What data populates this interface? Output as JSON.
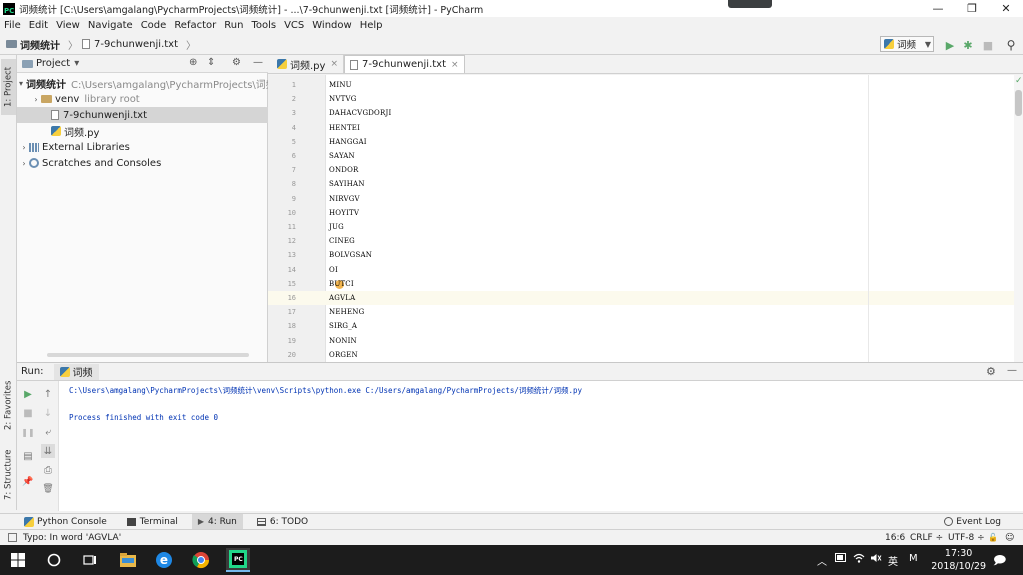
{
  "window": {
    "title": "词频统计 [C:\\Users\\amgalang\\PycharmProjects\\词频统计] - ...\\7-9chunwenji.txt [词频统计] - PyCharm",
    "app_icon_text": "PC",
    "minimize": "—",
    "maximize": "❐",
    "close": "✕"
  },
  "menu": [
    "File",
    "Edit",
    "View",
    "Navigate",
    "Code",
    "Refactor",
    "Run",
    "Tools",
    "VCS",
    "Window",
    "Help"
  ],
  "breadcrumb": {
    "project": "词频统计",
    "file": "7-9chunwenji.txt"
  },
  "run_config": {
    "label": "词频",
    "dropdown": "▼"
  },
  "toolbar_icons": {
    "run": "▶",
    "debug": "✱",
    "stop": "■",
    "search": "⚲"
  },
  "left_tabs": {
    "project": "1: Project",
    "favorites": "2: Favorites",
    "structure": "7: Structure"
  },
  "project_panel": {
    "title": "Project",
    "dropdown": "▾",
    "icons": {
      "locate": "⊕",
      "collapse": "⇕",
      "settings": "⚙",
      "hide": "—"
    },
    "tree": [
      {
        "label": "词频统计",
        "extra": "C:\\Users\\amgalang\\PycharmProjects\\词频统",
        "arrow": "▾"
      },
      {
        "label": "venv",
        "extra": "library root",
        "arrow": "›"
      },
      {
        "label": "7-9chunwenji.txt",
        "extra": "",
        "arrow": ""
      },
      {
        "label": "词频.py",
        "extra": "",
        "arrow": ""
      },
      {
        "label": "External Libraries",
        "extra": "",
        "arrow": "›"
      },
      {
        "label": "Scratches and Consoles",
        "extra": "",
        "arrow": "›"
      }
    ]
  },
  "editor": {
    "tabs": [
      {
        "label": "词频.py",
        "close": "×"
      },
      {
        "label": "7-9chunwenji.txt",
        "close": "×"
      }
    ],
    "line_numbers": [
      "1",
      "2",
      "3",
      "4",
      "5",
      "6",
      "7",
      "8",
      "9",
      "10",
      "11",
      "12",
      "13",
      "14",
      "15",
      "16",
      "17",
      "18",
      "19",
      "20"
    ],
    "lines": [
      "MINU",
      "NVTVG",
      "DAHACVGDORJI",
      "HENTEI",
      "HANGGAI",
      "SAYAN",
      "ONDOR",
      "SAYIHAN",
      "NIRVGV",
      "HOYITV",
      "JUG",
      "CINEG",
      "BOLVGSAN",
      "OI",
      "BUTCI",
      "AGVLA",
      "NEHENG",
      "SIRG_A",
      "NONIN",
      "ORGEN"
    ],
    "current_line": 16,
    "check": "✓"
  },
  "run_panel": {
    "label": "Run:",
    "tab": "词频",
    "settings": "⚙",
    "hide": "—",
    "command": "C:\\Users\\amgalang\\PycharmProjects\\词频统计\\venv\\Scripts\\python.exe C:/Users/amgalang/PycharmProjects/词频统计/词频.py",
    "exit_message": "Process finished with exit code 0",
    "toolbar": {
      "rerun": "▶",
      "up": "↑",
      "stop": "■",
      "down": "↓",
      "pause": "❚❚",
      "wrap": "⤶",
      "dump": "▤",
      "scroll_end": "⇊",
      "pin": "📌",
      "print": "⎙",
      "trash": "🗑"
    }
  },
  "bottom_tools": [
    {
      "label": "Python Console",
      "active": false
    },
    {
      "label": "Terminal",
      "active": false
    },
    {
      "label": "4: Run",
      "active": true
    },
    {
      "label": "6: TODO",
      "active": false
    }
  ],
  "event_log": "Event Log",
  "status": {
    "message": "Typo: In word 'AGVLA'",
    "position": "16:6",
    "line_sep": "CRLF ÷",
    "encoding": "UTF-8 ÷",
    "lock": "🔓",
    "hector": "☺"
  },
  "taskbar": {
    "time": "17:30",
    "date": "2018/10/29",
    "ime": "英",
    "ime2": "M",
    "chevron": "︿",
    "notif": "🗩"
  },
  "colors": {
    "current_line": "#fcfaed",
    "console_text": "#0033b3",
    "run_green": "#59a869"
  }
}
